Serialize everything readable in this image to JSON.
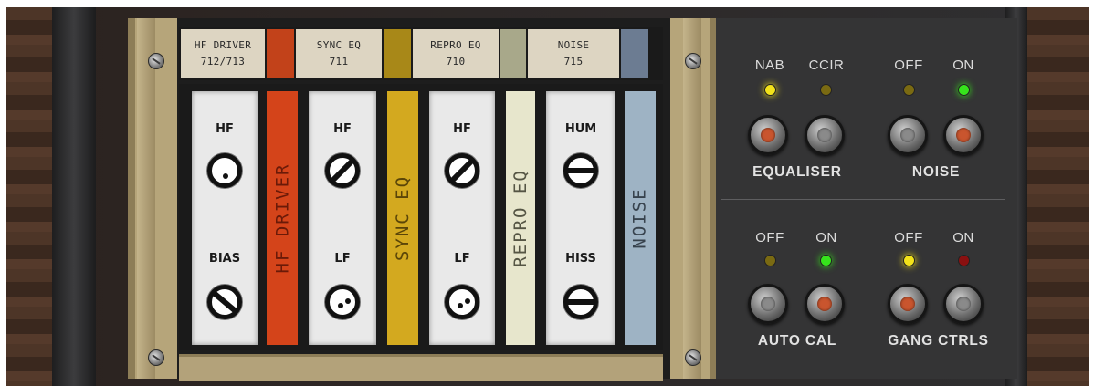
{
  "labels": [
    {
      "name": "HF DRIVER",
      "num": "712/713",
      "swatch": "#c2421a"
    },
    {
      "name": "SYNC EQ",
      "num": "711",
      "swatch": "#a88818"
    },
    {
      "name": "REPRO EQ",
      "num": "710",
      "swatch": "#a8a88a"
    },
    {
      "name": "NOISE",
      "num": "715",
      "swatch": "#6c7c92"
    }
  ],
  "modules": {
    "hf_driver": {
      "top_label": "HF",
      "bottom_label": "BIAS",
      "plate": "HF DRIVER",
      "plate_color": "#d4441a",
      "text_color": "#6a1a08"
    },
    "sync_eq": {
      "top_label": "HF",
      "bottom_label": "LF",
      "plate": "SYNC EQ",
      "plate_color": "#d3a91f",
      "text_color": "#5a4508"
    },
    "repro_eq": {
      "top_label": "HF",
      "bottom_label": "LF",
      "plate": "REPRO EQ",
      "plate_color": "#e7e6cc",
      "text_color": "#555544"
    },
    "noise": {
      "top_label": "HUM",
      "bottom_label": "HISS",
      "plate": "NOISE",
      "plate_color": "#9eb3c4",
      "text_color": "#37424d"
    }
  },
  "panel": {
    "equaliser": {
      "title": "EQUALISER",
      "left_label": "NAB",
      "right_label": "CCIR",
      "left_led": "on",
      "right_led": "off",
      "selected": "NAB"
    },
    "noise": {
      "title": "NOISE",
      "left_label": "OFF",
      "right_label": "ON",
      "left_led": "off",
      "right_led": "on",
      "selected": "ON"
    },
    "auto_cal": {
      "title": "AUTO CAL",
      "left_label": "OFF",
      "right_label": "ON",
      "left_led": "off",
      "right_led": "on",
      "selected": "ON"
    },
    "gang_ctrls": {
      "title": "GANG CTRLS",
      "left_label": "OFF",
      "right_label": "ON",
      "left_led": "on",
      "right_led": "off",
      "selected": "OFF"
    }
  },
  "colors": {
    "led_yellow": "#f2e21a",
    "led_green": "#36e31c",
    "led_off": "#7a6a12",
    "led_red_off": "#8a1010",
    "cap_active": "#c9552e",
    "cap_idle": "#8a8a8a"
  }
}
